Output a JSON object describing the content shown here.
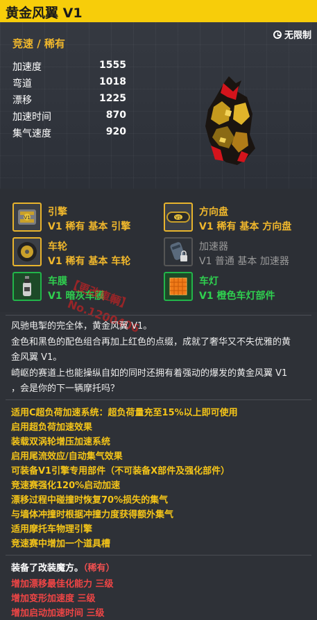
{
  "title": "黄金风翼 V1",
  "header": {
    "rarity": "竞速 / 稀有",
    "limit": "无限制",
    "stats": [
      {
        "name": "加速度",
        "value": "1555"
      },
      {
        "name": "弯道",
        "value": "1018"
      },
      {
        "name": "漂移",
        "value": "1225"
      },
      {
        "name": "加速时间",
        "value": "870"
      },
      {
        "name": "集气速度",
        "value": "920"
      }
    ]
  },
  "parts": [
    {
      "name": "引擎",
      "desc": "V1 稀有 基本 引擎",
      "icon": "engine-icon"
    },
    {
      "name": "方向盘",
      "desc": "V1 稀有 基本 方向盘",
      "icon": "steering-wheel-icon"
    },
    {
      "name": "车轮",
      "desc": "V1 稀有 基本 车轮",
      "icon": "wheel-icon"
    },
    {
      "name": "加速器",
      "desc": "V1 普通 基本 加速器",
      "icon": "booster-icon"
    },
    {
      "name": "车膜",
      "desc": "V1 暗灰车膜",
      "icon": "spray-can-icon"
    },
    {
      "name": "车灯",
      "desc": "V1 橙色车灯部件",
      "icon": "light-grid-icon"
    }
  ],
  "description": [
    "风驰电掣的完全体，黄金风翼 V1。",
    "金色和黑色的配色组合再加上红色的点缀，成就了奢华又不失优雅的黄",
    "金风翼 V1。",
    "崎岖的赛道上也能操纵自如的同时还拥有着强动的爆发的黄金风翼 V1",
    "，会是你的下一辆摩托吗？"
  ],
  "features": [
    "适用C超负荷加速系统：超负荷量充至15%以上即可使用",
    "启用超负荷加速效果",
    "装载双涡轮增压加速系统",
    "启用尾流效应/自动集气效果",
    "可装备V1引擎专用部件（不可装备X部件及强化部件）",
    "竞速赛强化120%启动加速",
    "漂移过程中碰撞时恢复70%损失的集气",
    "与墙体冲撞时根据冲撞力度获得额外集气",
    "适用摩托车物理引擎",
    "竞速赛中增加一个道具槽"
  ],
  "modifiers": {
    "title": "装备了改装魔方。",
    "rarity": "（稀有）",
    "items": [
      "增加漂移最佳化能力 三级",
      "增加变形加速度 三级",
      "增加启动加速时间 三级"
    ]
  },
  "watermark": [
    "【更改車輌】",
    "No.1200406"
  ],
  "colors": {
    "title_bar": "#f7cd0a",
    "rare": "#f0b72c",
    "feature": "#f5c518",
    "skin": "#2fd04f",
    "modifier": "#f04545"
  }
}
